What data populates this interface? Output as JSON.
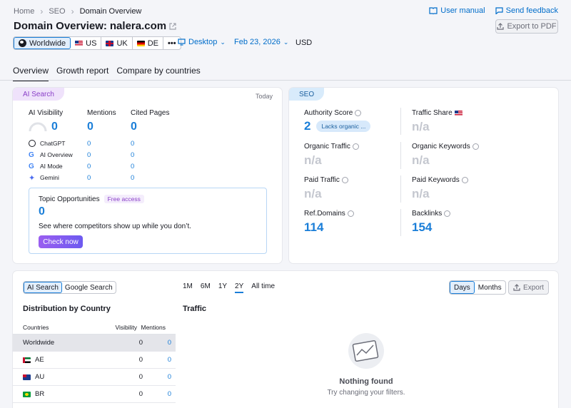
{
  "breadcrumb": [
    "Home",
    "SEO",
    "Domain Overview"
  ],
  "top_links": {
    "user_manual": "User manual",
    "send_feedback": "Send feedback"
  },
  "title": {
    "prefix": "Domain Overview:",
    "domain": "nalera.com"
  },
  "export_pdf": "Export to PDF",
  "databases": [
    {
      "label": "Worldwide",
      "active": true
    },
    {
      "label": "US"
    },
    {
      "label": "UK"
    },
    {
      "label": "DE"
    },
    {
      "label": "•••"
    }
  ],
  "device": "Desktop",
  "date": "Feb 23, 2026",
  "currency": "USD",
  "tabs": [
    "Overview",
    "Growth report",
    "Compare by countries"
  ],
  "ai_search": {
    "pill": "AI Search",
    "today": "Today",
    "cols": [
      "AI Visibility",
      "Mentions",
      "Cited Pages"
    ],
    "totals": [
      "0",
      "0",
      "0"
    ],
    "rows": [
      {
        "name": "ChatGPT",
        "mentions": "0",
        "cited": "0"
      },
      {
        "name": "AI Overview",
        "mentions": "0",
        "cited": "0"
      },
      {
        "name": "AI Mode",
        "mentions": "0",
        "cited": "0"
      },
      {
        "name": "Gemini",
        "mentions": "0",
        "cited": "0"
      }
    ],
    "topic": {
      "title": "Topic Opportunities",
      "badge": "Free access",
      "value": "0",
      "desc": "See where competitors show up while you don’t.",
      "button": "Check now"
    }
  },
  "seo": {
    "pill": "SEO",
    "authority_score": {
      "label": "Authority Score",
      "value": "2",
      "badge": "Lacks organic ..."
    },
    "traffic_share": {
      "label": "Traffic Share",
      "value": "n/a"
    },
    "organic_traffic": {
      "label": "Organic Traffic",
      "value": "n/a"
    },
    "organic_keywords": {
      "label": "Organic Keywords",
      "value": "n/a"
    },
    "paid_traffic": {
      "label": "Paid Traffic",
      "value": "n/a"
    },
    "paid_keywords": {
      "label": "Paid Keywords",
      "value": "n/a"
    },
    "ref_domains": {
      "label": "Ref.Domains",
      "value": "114"
    },
    "backlinks": {
      "label": "Backlinks",
      "value": "154"
    }
  },
  "bottom": {
    "search_toggle": [
      "AI Search",
      "Google Search"
    ],
    "periods": [
      "1M",
      "6M",
      "1Y",
      "2Y",
      "All time"
    ],
    "active_period": "2Y",
    "granularity": [
      "Days",
      "Months"
    ],
    "export": "Export",
    "dist_title": "Distribution by Country",
    "traffic_title": "Traffic",
    "table_headers": [
      "Countries",
      "Visibility",
      "Mentions"
    ],
    "table_rows": [
      {
        "country": "Worldwide",
        "visibility": "0",
        "mentions": "0"
      },
      {
        "country": "AE",
        "visibility": "0",
        "mentions": "0"
      },
      {
        "country": "AU",
        "visibility": "0",
        "mentions": "0"
      },
      {
        "country": "BR",
        "visibility": "0",
        "mentions": "0"
      }
    ],
    "empty_title": "Nothing found",
    "empty_desc": "Try changing your filters."
  }
}
